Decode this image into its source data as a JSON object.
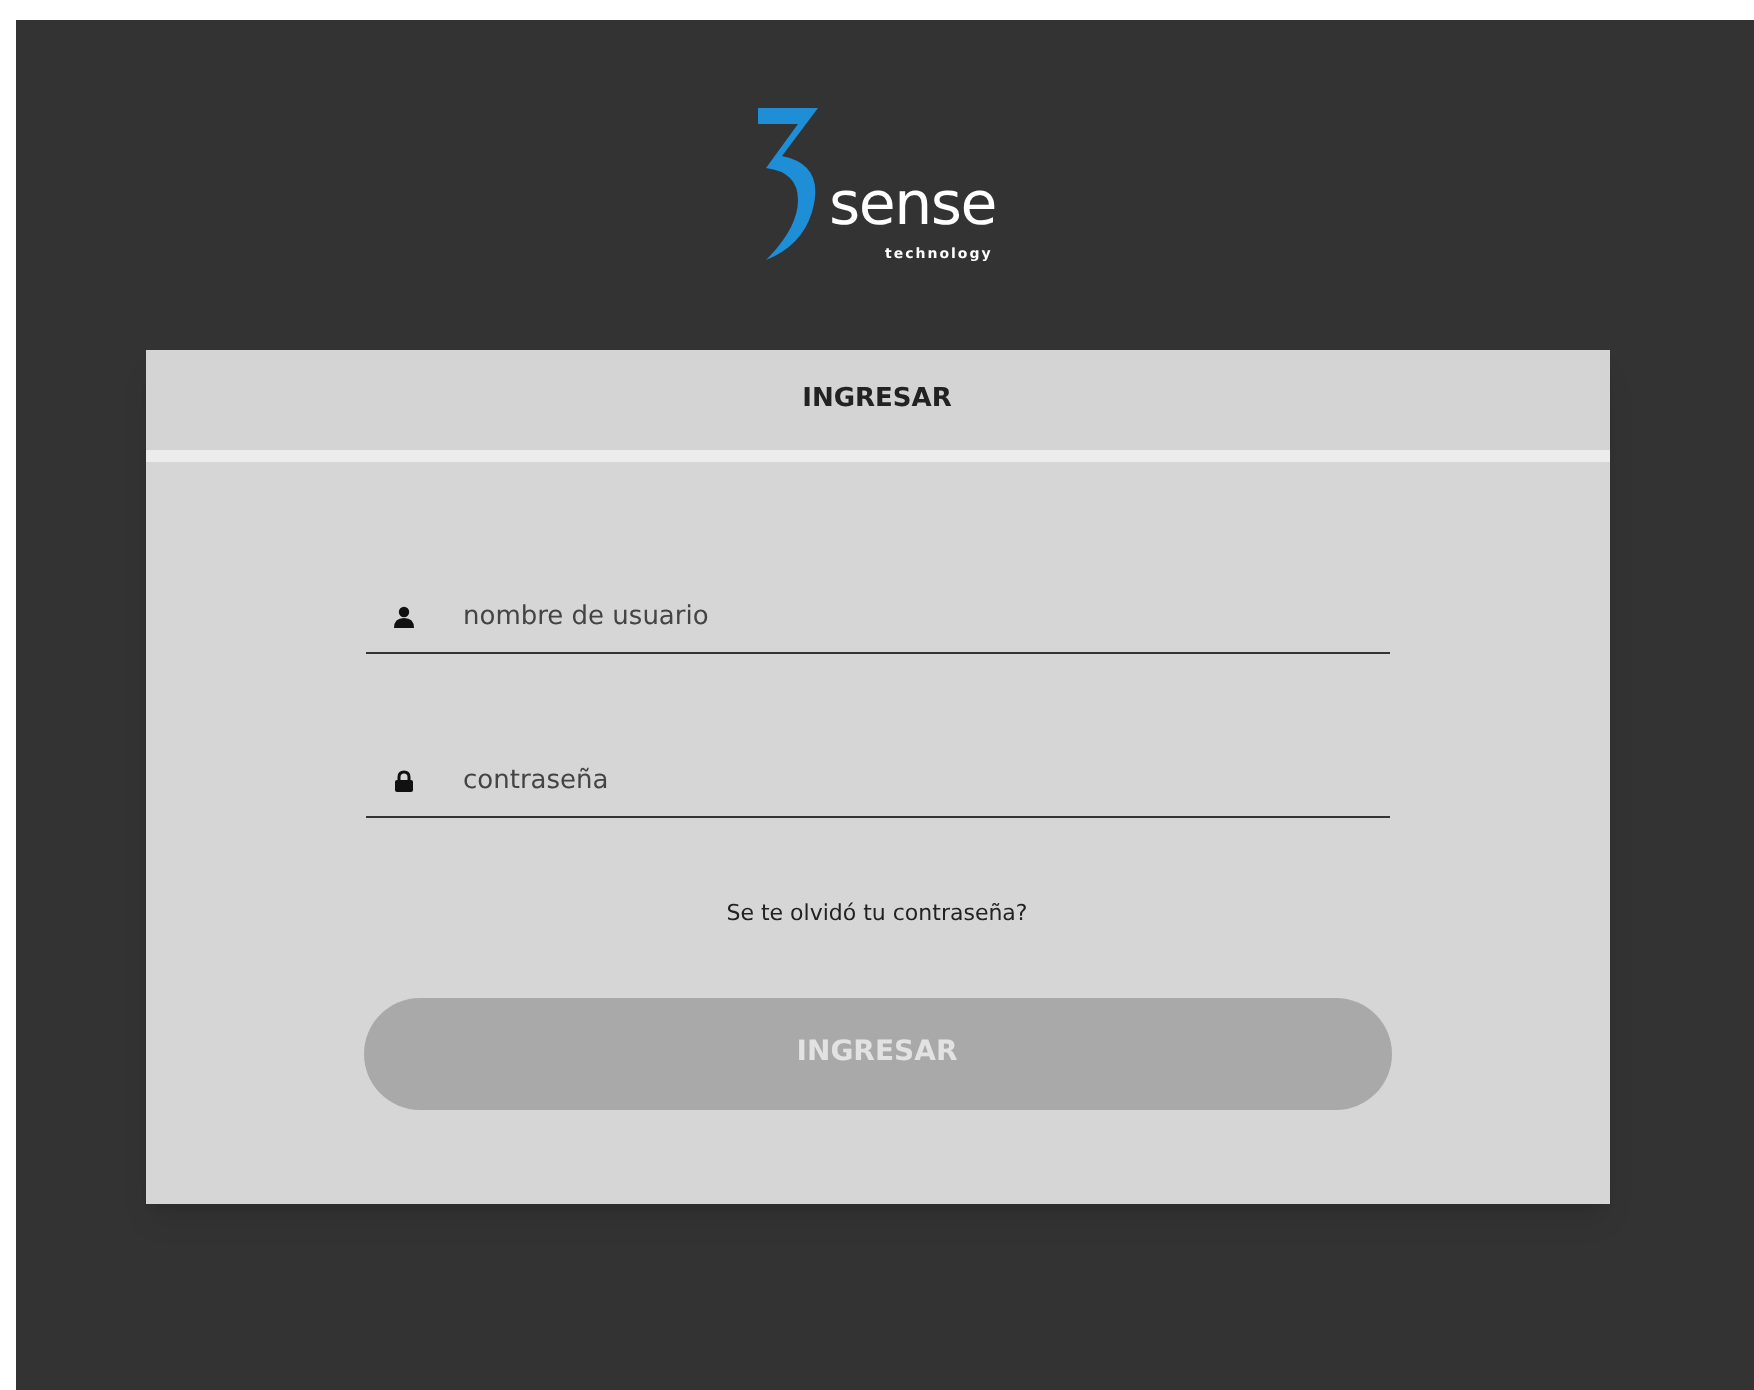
{
  "logo": {
    "wordmark": "sense",
    "tagline": "technology"
  },
  "card": {
    "title": "INGRESAR",
    "fields": [
      {
        "kind": "user",
        "placeholder": "nombre de usuario"
      },
      {
        "kind": "password",
        "placeholder": "contraseña"
      }
    ],
    "forgot_link": "Se te olvidó tu contraseña?",
    "submit": {
      "label": "INGRESAR",
      "disabled": true
    }
  }
}
